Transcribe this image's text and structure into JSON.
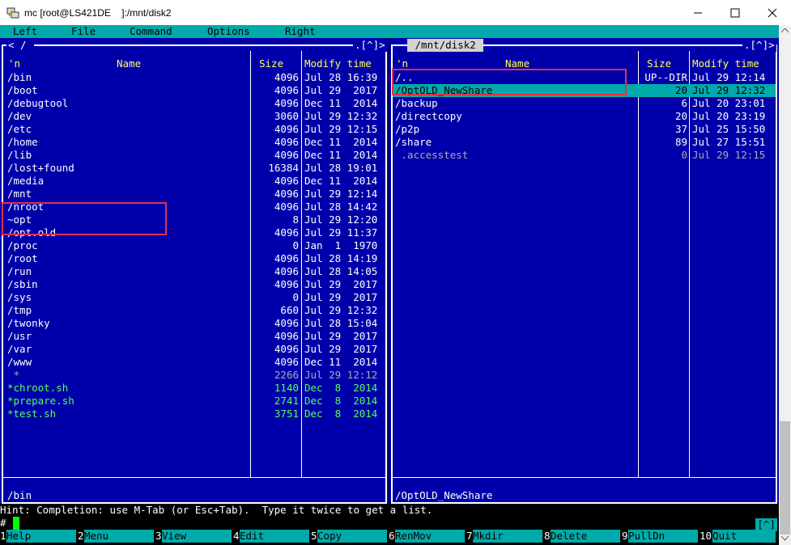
{
  "window": {
    "title": "mc [root@LS421DE    ]:/mnt/disk2"
  },
  "menubar": {
    "items": [
      "Left",
      "File",
      "Command",
      "Options",
      "Right"
    ]
  },
  "left_panel": {
    "path_title": "< / ",
    "corner_hint": ".[^]>",
    "headers": {
      "n": "'n",
      "name": "Name",
      "size": "Size",
      "modify": "Modify time"
    },
    "rows": [
      {
        "name": "/bin",
        "size": "4096",
        "date": "Jul 28 16:39",
        "type": "dir"
      },
      {
        "name": "/boot",
        "size": "4096",
        "date": "Jul 29  2017",
        "type": "dir"
      },
      {
        "name": "/debugtool",
        "size": "4096",
        "date": "Dec 11  2014",
        "type": "dir"
      },
      {
        "name": "/dev",
        "size": "3060",
        "date": "Jul 29 12:32",
        "type": "dir"
      },
      {
        "name": "/etc",
        "size": "4096",
        "date": "Jul 29 12:15",
        "type": "dir"
      },
      {
        "name": "/home",
        "size": "4096",
        "date": "Dec 11  2014",
        "type": "dir"
      },
      {
        "name": "/lib",
        "size": "4096",
        "date": "Dec 11  2014",
        "type": "dir"
      },
      {
        "name": "/lost+found",
        "size": "16384",
        "date": "Jul 28 19:01",
        "type": "dir"
      },
      {
        "name": "/media",
        "size": "4096",
        "date": "Dec 11  2014",
        "type": "dir"
      },
      {
        "name": "/mnt",
        "size": "4096",
        "date": "Jul 29 12:14",
        "type": "dir"
      },
      {
        "name": "/nroot",
        "size": "4096",
        "date": "Jul 28 14:42",
        "type": "dir"
      },
      {
        "name": "~opt",
        "size": "8",
        "date": "Jul 29 12:20",
        "type": "link"
      },
      {
        "name": "/opt.old",
        "size": "4096",
        "date": "Jul 29 11:37",
        "type": "dir"
      },
      {
        "name": "/proc",
        "size": "0",
        "date": "Jan  1  1970",
        "type": "dir"
      },
      {
        "name": "/root",
        "size": "4096",
        "date": "Jul 28 14:19",
        "type": "dir"
      },
      {
        "name": "/run",
        "size": "4096",
        "date": "Jul 28 14:05",
        "type": "dir"
      },
      {
        "name": "/sbin",
        "size": "4096",
        "date": "Jul 29  2017",
        "type": "dir"
      },
      {
        "name": "/sys",
        "size": "0",
        "date": "Jul 29  2017",
        "type": "dir"
      },
      {
        "name": "/tmp",
        "size": "660",
        "date": "Jul 29 12:32",
        "type": "dir"
      },
      {
        "name": "/twonky",
        "size": "4096",
        "date": "Jul 28 15:04",
        "type": "dir"
      },
      {
        "name": "/usr",
        "size": "4096",
        "date": "Jul 29  2017",
        "type": "dir"
      },
      {
        "name": "/var",
        "size": "4096",
        "date": "Jul 29  2017",
        "type": "dir"
      },
      {
        "name": "/www",
        "size": "4096",
        "date": "Dec 11  2014",
        "type": "dir"
      },
      {
        "name": " *",
        "size": "2266",
        "date": "Jul 29 12:12",
        "type": "dim"
      },
      {
        "name": "*chroot.sh",
        "size": "1140",
        "date": "Dec  8  2014",
        "type": "exec"
      },
      {
        "name": "*prepare.sh",
        "size": "2741",
        "date": "Dec  8  2014",
        "type": "exec"
      },
      {
        "name": "*test.sh",
        "size": "3751",
        "date": "Dec  8  2014",
        "type": "exec"
      }
    ],
    "status": "/bin"
  },
  "right_panel": {
    "path_title": " /mnt/disk2 ",
    "corner_hint": ".[^]>",
    "headers": {
      "n": "'n",
      "name": "Name",
      "size": "Size",
      "modify": "Modify time"
    },
    "rows": [
      {
        "name": "/..",
        "size": "UP--DIR",
        "date": "Jul 29 12:14",
        "type": "dir"
      },
      {
        "name": "/OptOLD_NewShare",
        "size": "20",
        "date": "Jul 29 12:32",
        "type": "selected"
      },
      {
        "name": "/backup",
        "size": "6",
        "date": "Jul 20 23:01",
        "type": "dir"
      },
      {
        "name": "/directcopy",
        "size": "20",
        "date": "Jul 20 23:19",
        "type": "dir"
      },
      {
        "name": "/p2p",
        "size": "37",
        "date": "Jul 25 15:50",
        "type": "dir"
      },
      {
        "name": "/share",
        "size": "89",
        "date": "Jul 27 15:51",
        "type": "dir"
      },
      {
        "name": " .accesstest",
        "size": "0",
        "date": "Jul 29 12:15",
        "type": "dim"
      }
    ],
    "status": "/OptOLD_NewShare"
  },
  "hint": "Hint: Completion: use M-Tab (or Esc+Tab).  Type it twice to get a list.",
  "prompt": "#",
  "scroll_hint": "[^]",
  "fkeys": [
    {
      "num": "1",
      "label": "Help"
    },
    {
      "num": "2",
      "label": "Menu"
    },
    {
      "num": "3",
      "label": "View"
    },
    {
      "num": "4",
      "label": "Edit"
    },
    {
      "num": "5",
      "label": "Copy"
    },
    {
      "num": "6",
      "label": "RenMov"
    },
    {
      "num": "7",
      "label": "Mkdir"
    },
    {
      "num": "8",
      "label": "Delete"
    },
    {
      "num": "9",
      "label": "PullDn"
    },
    {
      "num": "10",
      "label": "Quit"
    }
  ],
  "colors": {
    "panel_bg": "#0000aa",
    "cyan": "#00aaaa",
    "header_yellow": "#ffff55",
    "exec_green": "#55ff55",
    "annotation_red": "#e0304a"
  }
}
